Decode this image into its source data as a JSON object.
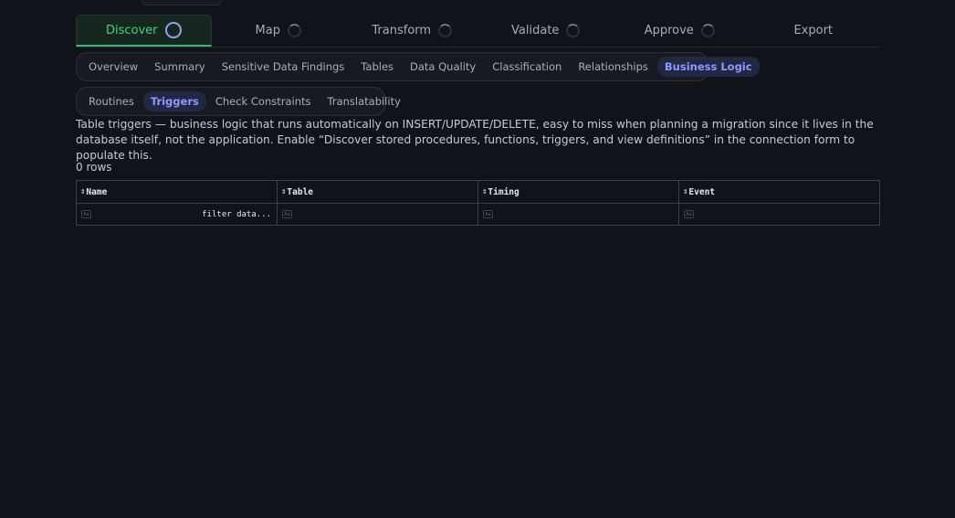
{
  "stepper": [
    {
      "label": "Discover",
      "state": "active"
    },
    {
      "label": "Map",
      "state": "idle"
    },
    {
      "label": "Transform",
      "state": "idle"
    },
    {
      "label": "Validate",
      "state": "idle"
    },
    {
      "label": "Approve",
      "state": "idle"
    },
    {
      "label": "Export",
      "state": "none"
    }
  ],
  "tabs": [
    "Overview",
    "Summary",
    "Sensitive Data Findings",
    "Tables",
    "Data Quality",
    "Classification",
    "Relationships",
    "Business Logic"
  ],
  "subtabs": [
    "Routines",
    "Triggers",
    "Check Constraints",
    "Translatability"
  ],
  "description": "Table triggers — business logic that runs automatically on INSERT/UPDATE/DELETE, easy to miss when planning a migration since it lives in the database itself, not the application. Enable “Discover stored procedures, functions, triggers, and view definitions” in the connection form to populate this.",
  "row_count": "0 rows",
  "table": {
    "columns": [
      "Name",
      "Table",
      "Timing",
      "Event"
    ],
    "filter_placeholder": "filter data...",
    "filter_icon_text": "Aa",
    "sort_glyph": "⇕"
  },
  "colors": {
    "accent_green": "#3fd483",
    "accent_blue": "#8d9bff",
    "background": "#11131a"
  }
}
